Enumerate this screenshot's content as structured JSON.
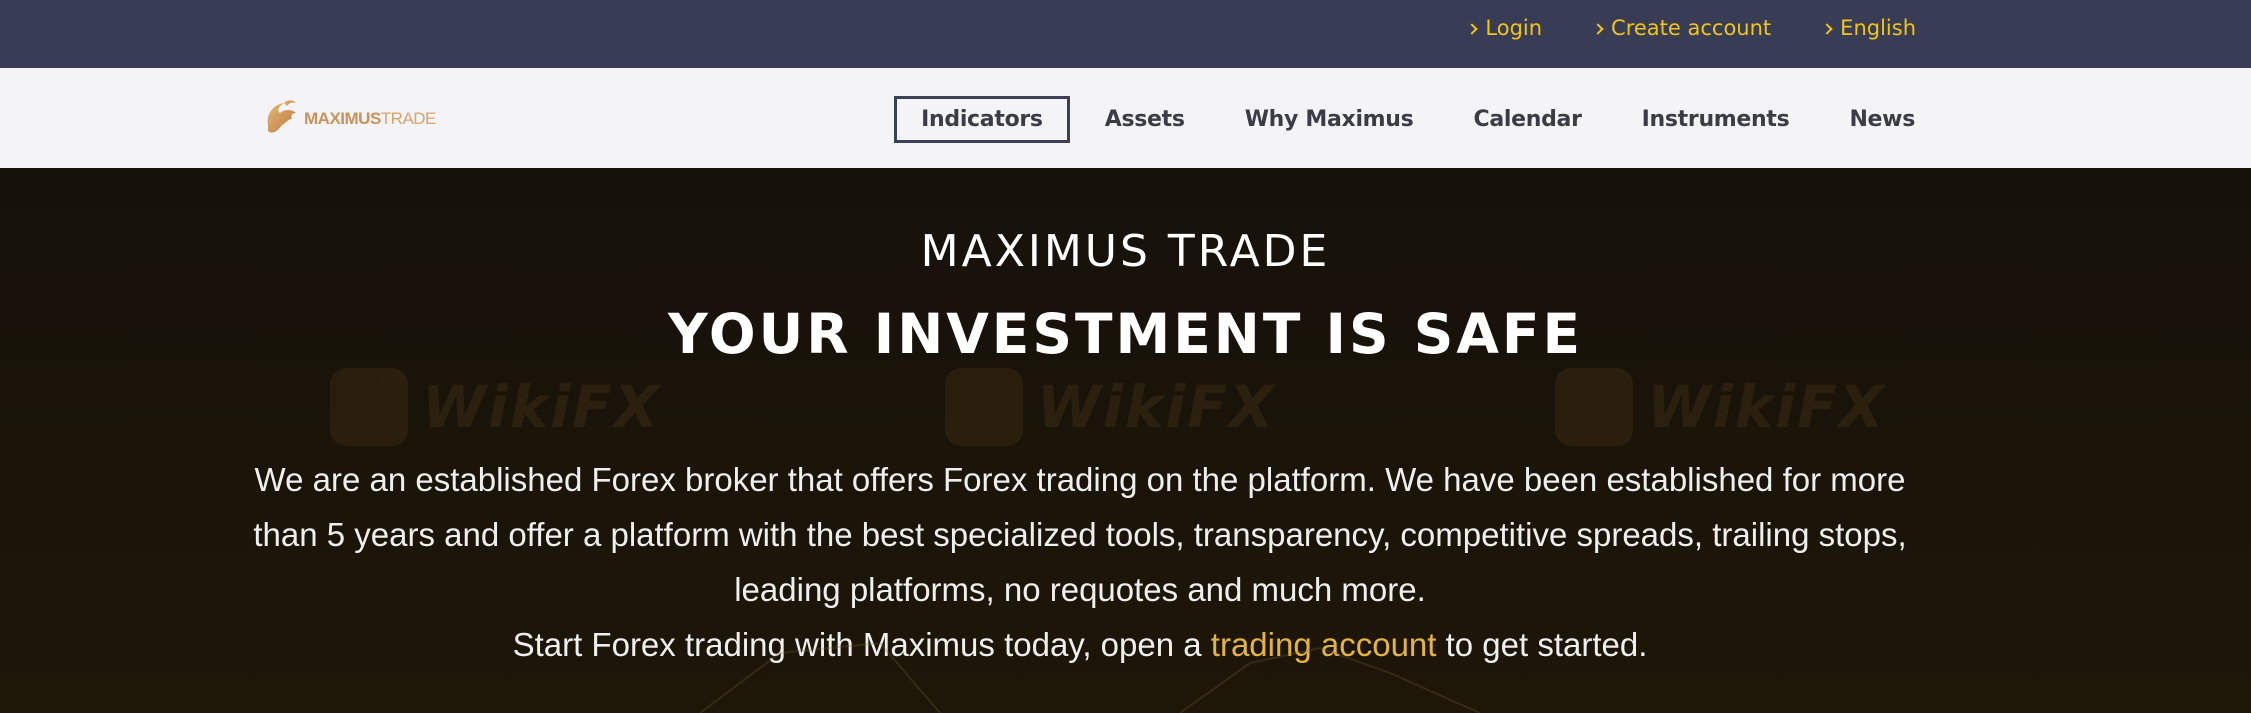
{
  "topbar": {
    "links": [
      {
        "label": "Login"
      },
      {
        "label": "Create account"
      },
      {
        "label": "English"
      }
    ]
  },
  "brand": {
    "name_bold": "MAXIMUS",
    "name_light": "TRADE",
    "colors": {
      "gold": "#c7935a",
      "accent": "#f0c419"
    }
  },
  "nav": {
    "items": [
      {
        "label": "Indicators",
        "active": true
      },
      {
        "label": "Assets"
      },
      {
        "label": "Why Maximus"
      },
      {
        "label": "Calendar"
      },
      {
        "label": "Instruments"
      },
      {
        "label": "News"
      }
    ]
  },
  "hero": {
    "eyebrow": "MAXIMUS TRADE",
    "title": "YOUR INVESTMENT IS SAFE",
    "line1": "We are an established Forex broker that offers Forex trading on the platform. We have been established for more than 5 years and offer a platform with the best specialized tools, transparency, competitive spreads, trailing stops, leading platforms, no requotes and much more.",
    "line2_before": "Start Forex trading with Maximus today, open a ",
    "line2_link": "trading account",
    "line2_after": " to get started."
  },
  "watermark": {
    "text": "WikiFX"
  }
}
